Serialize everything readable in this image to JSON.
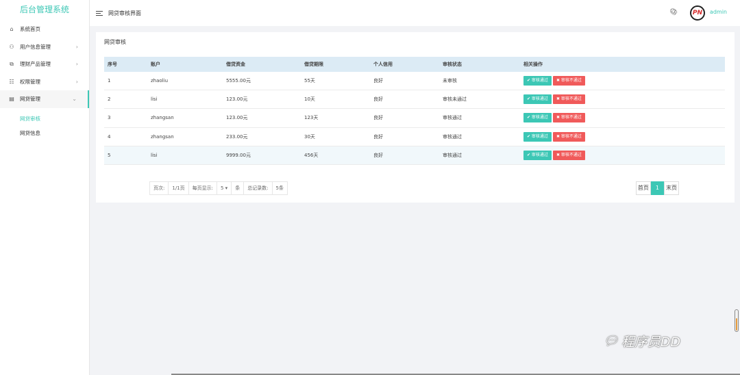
{
  "sidebar": {
    "logo": "后台管理系统",
    "items": [
      {
        "label": "系统首页",
        "icon": "home-icon",
        "glyph": "⌂",
        "has_chevron": false
      },
      {
        "label": "用户信息管理",
        "icon": "users-icon",
        "glyph": "⚇",
        "has_chevron": true
      },
      {
        "label": "理财产品管理",
        "icon": "copy-icon",
        "glyph": "⧉",
        "has_chevron": true
      },
      {
        "label": "权限管理",
        "icon": "sliders-icon",
        "glyph": "☷",
        "has_chevron": true
      },
      {
        "label": "网贷管理",
        "icon": "message-icon",
        "glyph": "▤",
        "has_chevron": true
      }
    ],
    "submenu": [
      "网贷审核",
      "网贷信息"
    ]
  },
  "topbar": {
    "title": "网贷审核界面",
    "user": "admin",
    "avatar_text": "PN"
  },
  "panel": {
    "title": "网贷审核"
  },
  "table": {
    "headers": [
      "序号",
      "账户",
      "借贷资金",
      "借贷期限",
      "个人信用",
      "审核状态",
      "相关操作"
    ],
    "approve_label": "✔ 审核通过",
    "reject_label": "✖ 审核不通过",
    "rows": [
      {
        "no": "1",
        "account": "zhaoliu",
        "amount": "5555.00元",
        "term": "55天",
        "credit": "良好",
        "status": "未审核"
      },
      {
        "no": "2",
        "account": "lisi",
        "amount": "123.00元",
        "term": "10天",
        "credit": "良好",
        "status": "审核未通过"
      },
      {
        "no": "3",
        "account": "zhangsan",
        "amount": "123.00元",
        "term": "123天",
        "credit": "良好",
        "status": "审核通过"
      },
      {
        "no": "4",
        "account": "zhangsan",
        "amount": "233.00元",
        "term": "30天",
        "credit": "良好",
        "status": "审核通过"
      },
      {
        "no": "5",
        "account": "lisi",
        "amount": "9999.00元",
        "term": "456天",
        "credit": "良好",
        "status": "审核通过"
      }
    ]
  },
  "pager": {
    "page_label": "页次:",
    "page_value": "1/1页",
    "per_page_label": "每页显示:",
    "per_page_value": "5 ▾",
    "per_page_unit": "条",
    "total_label": "总记录数:",
    "total_value": "5条",
    "first": "首页",
    "current": "1",
    "last": "末页"
  },
  "watermark": {
    "text": "程序员DD"
  },
  "colors": {
    "accent": "#3cc7b5",
    "danger": "#f05a5a",
    "table_header": "#dcebf5"
  }
}
